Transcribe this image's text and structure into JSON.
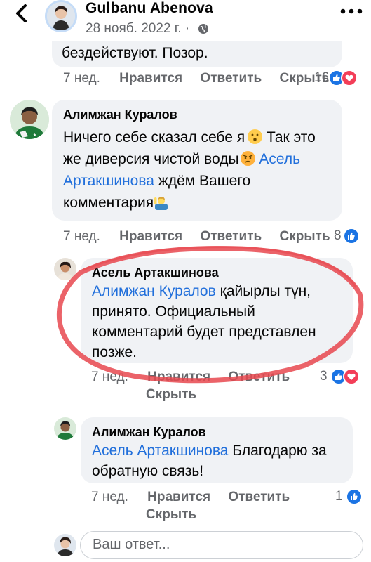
{
  "header": {
    "author": "Gulbanu Abenova",
    "date": "28 нояб. 2022 г. ·",
    "icons": {
      "back": "chevron-left-icon",
      "privacy": "globe-icon",
      "more": "more-dots-icon"
    }
  },
  "comments": [
    {
      "id": "c0",
      "partial_text": "бездействуют. Позор.",
      "time": "7 нед.",
      "like_label": "Нравится",
      "reply_label": "Ответить",
      "hide_label": "Скрыть",
      "reactions": {
        "count": "16",
        "types": [
          "like",
          "love"
        ]
      }
    },
    {
      "id": "c1",
      "author": "Алимжан Куралов",
      "lines": [
        "Ничего себе сказал себе я",
        "Так это",
        "же диверсия чистой воды",
        "Асель",
        "Артакшинова",
        "ждём Вашего",
        "комментария"
      ],
      "emojis": [
        "hushed-face-emoji",
        "angry-face-emoji",
        "person-raising-hand-emoji"
      ],
      "time": "7 нед.",
      "like_label": "Нравится",
      "reply_label": "Ответить",
      "hide_label": "Скрыть",
      "reactions": {
        "count": "8",
        "types": [
          "like"
        ]
      }
    },
    {
      "id": "c2",
      "author": "Асель Артакшинова",
      "mention": "Алимжан Куралов",
      "text_after_mention": "қайырлы түн,",
      "lines": [
        "принято. Официальный",
        "комментарий будет представлен",
        "позже."
      ],
      "time": "7 нед.",
      "like_label": "Нравится",
      "reply_label": "Ответить",
      "hide_label": "Скрыть",
      "reactions": {
        "count": "3",
        "types": [
          "like",
          "love"
        ]
      },
      "highlight_color": "#e8484f"
    },
    {
      "id": "c3",
      "author": "Алимжан Куралов",
      "mention": "Асель Артакшинова",
      "text_after_mention": "Благодарю за",
      "lines": [
        "обратную связь!"
      ],
      "time": "7 нед.",
      "like_label": "Нравится",
      "reply_label": "Ответить",
      "hide_label": "Скрыть",
      "reactions": {
        "count": "1",
        "types": [
          "like"
        ]
      }
    }
  ],
  "reply_box": {
    "placeholder": "Ваш ответ..."
  },
  "colors": {
    "link": "#216fdb",
    "bubble": "#f0f2f5",
    "meta": "#65676b",
    "like": "#1b74e4",
    "love": "#f33e58"
  }
}
